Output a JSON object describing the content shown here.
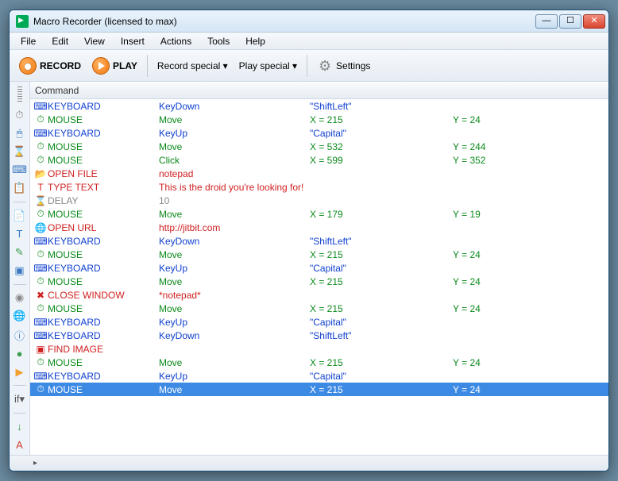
{
  "title": "Macro Recorder (licensed to max)",
  "menu": [
    "File",
    "Edit",
    "View",
    "Insert",
    "Actions",
    "Tools",
    "Help"
  ],
  "toolbar": {
    "record": "RECORD",
    "play": "PLAY",
    "record_special": "Record special ▾",
    "play_special": "Play special ▾",
    "settings": "Settings"
  },
  "side_icons": [
    {
      "name": "clock-icon",
      "glyph": "⏱",
      "color": "#888"
    },
    {
      "name": "mouse-icon",
      "glyph": "🖱",
      "color": "#3a78c0"
    },
    {
      "name": "hourglass-icon",
      "glyph": "⌛",
      "color": "#c08830"
    },
    {
      "name": "keyboard-icon",
      "glyph": "⌨",
      "color": "#3a78c0"
    },
    {
      "name": "copy-icon",
      "glyph": "📋",
      "color": "#888"
    },
    {
      "name": "paste-icon",
      "glyph": "📄",
      "color": "#4a90d0"
    },
    {
      "name": "text-icon",
      "glyph": "T",
      "color": "#3a78c0"
    },
    {
      "name": "eyedropper-icon",
      "glyph": "✎",
      "color": "#3aa050"
    },
    {
      "name": "image-icon",
      "glyph": "▣",
      "color": "#3a78c0"
    },
    {
      "name": "circle-icon",
      "glyph": "◉",
      "color": "#888"
    },
    {
      "name": "globe-icon",
      "glyph": "🌐",
      "color": "#3aa050"
    },
    {
      "name": "info-icon",
      "glyph": "ⓘ",
      "color": "#3a78c0"
    },
    {
      "name": "green-ball-icon",
      "glyph": "●",
      "color": "#3aa050"
    },
    {
      "name": "play-small-icon",
      "glyph": "▶",
      "color": "#f0a030"
    },
    {
      "name": "if-icon",
      "glyph": "if▾",
      "color": "#555"
    },
    {
      "name": "down-icon",
      "glyph": "↓",
      "color": "#3aa050"
    },
    {
      "name": "a-icon",
      "glyph": "A",
      "color": "#d04030"
    }
  ],
  "col_header": "Command",
  "rows": [
    {
      "icon": "⌨",
      "type": "KEYBOARD",
      "c2": "KeyDown",
      "c3": "\"ShiftLeft\"",
      "c4": "",
      "cls": "blue"
    },
    {
      "icon": "⏱",
      "type": "MOUSE",
      "c2": "Move",
      "c3": "X = 215",
      "c4": "Y = 24",
      "cls": "green"
    },
    {
      "icon": "⌨",
      "type": "KEYBOARD",
      "c2": "KeyUp",
      "c3": "\"Capital\"",
      "c4": "",
      "cls": "blue"
    },
    {
      "icon": "⏱",
      "type": "MOUSE",
      "c2": "Move",
      "c3": "X = 532",
      "c4": "Y = 244",
      "cls": "green"
    },
    {
      "icon": "⏱",
      "type": "MOUSE",
      "c2": "Click",
      "c3": "X = 599",
      "c4": "Y = 352",
      "cls": "green"
    },
    {
      "icon": "📂",
      "type": "OPEN FILE",
      "c2": "notepad",
      "c3": "",
      "c4": "",
      "cls": "red"
    },
    {
      "icon": "T",
      "type": "TYPE TEXT",
      "c2": "This is the droid you're looking for!",
      "c3": "",
      "c4": "",
      "cls": "red"
    },
    {
      "icon": "⌛",
      "type": "DELAY",
      "c2": "10",
      "c3": "",
      "c4": "",
      "cls": "gray"
    },
    {
      "icon": "⏱",
      "type": "MOUSE",
      "c2": "Move",
      "c3": "X = 179",
      "c4": "Y = 19",
      "cls": "green"
    },
    {
      "icon": "🌐",
      "type": "OPEN URL",
      "c2": "http://jitbit.com",
      "c3": "",
      "c4": "",
      "cls": "red"
    },
    {
      "icon": "⌨",
      "type": "KEYBOARD",
      "c2": "KeyDown",
      "c3": "\"ShiftLeft\"",
      "c4": "",
      "cls": "blue"
    },
    {
      "icon": "⏱",
      "type": "MOUSE",
      "c2": "Move",
      "c3": "X = 215",
      "c4": "Y = 24",
      "cls": "green"
    },
    {
      "icon": "⌨",
      "type": "KEYBOARD",
      "c2": "KeyUp",
      "c3": "\"Capital\"",
      "c4": "",
      "cls": "blue"
    },
    {
      "icon": "⏱",
      "type": "MOUSE",
      "c2": "Move",
      "c3": "X = 215",
      "c4": "Y = 24",
      "cls": "green"
    },
    {
      "icon": "✖",
      "type": "CLOSE WINDOW",
      "c2": "*notepad*",
      "c3": "",
      "c4": "",
      "cls": "red"
    },
    {
      "icon": "⏱",
      "type": "MOUSE",
      "c2": "Move",
      "c3": "X = 215",
      "c4": "Y = 24",
      "cls": "green"
    },
    {
      "icon": "⌨",
      "type": "KEYBOARD",
      "c2": "KeyUp",
      "c3": "\"Capital\"",
      "c4": "",
      "cls": "blue"
    },
    {
      "icon": "⌨",
      "type": "KEYBOARD",
      "c2": "KeyDown",
      "c3": "\"ShiftLeft\"",
      "c4": "",
      "cls": "blue"
    },
    {
      "icon": "▣",
      "type": "FIND IMAGE",
      "c2": "",
      "c3": "",
      "c4": "",
      "cls": "red"
    },
    {
      "icon": "⏱",
      "type": "MOUSE",
      "c2": "Move",
      "c3": "X = 215",
      "c4": "Y = 24",
      "cls": "green"
    },
    {
      "icon": "⌨",
      "type": "KEYBOARD",
      "c2": "KeyUp",
      "c3": "\"Capital\"",
      "c4": "",
      "cls": "blue"
    },
    {
      "icon": "⏱",
      "type": "MOUSE",
      "c2": "Move",
      "c3": "X = 215",
      "c4": "Y = 24",
      "cls": "green",
      "sel": true
    }
  ]
}
